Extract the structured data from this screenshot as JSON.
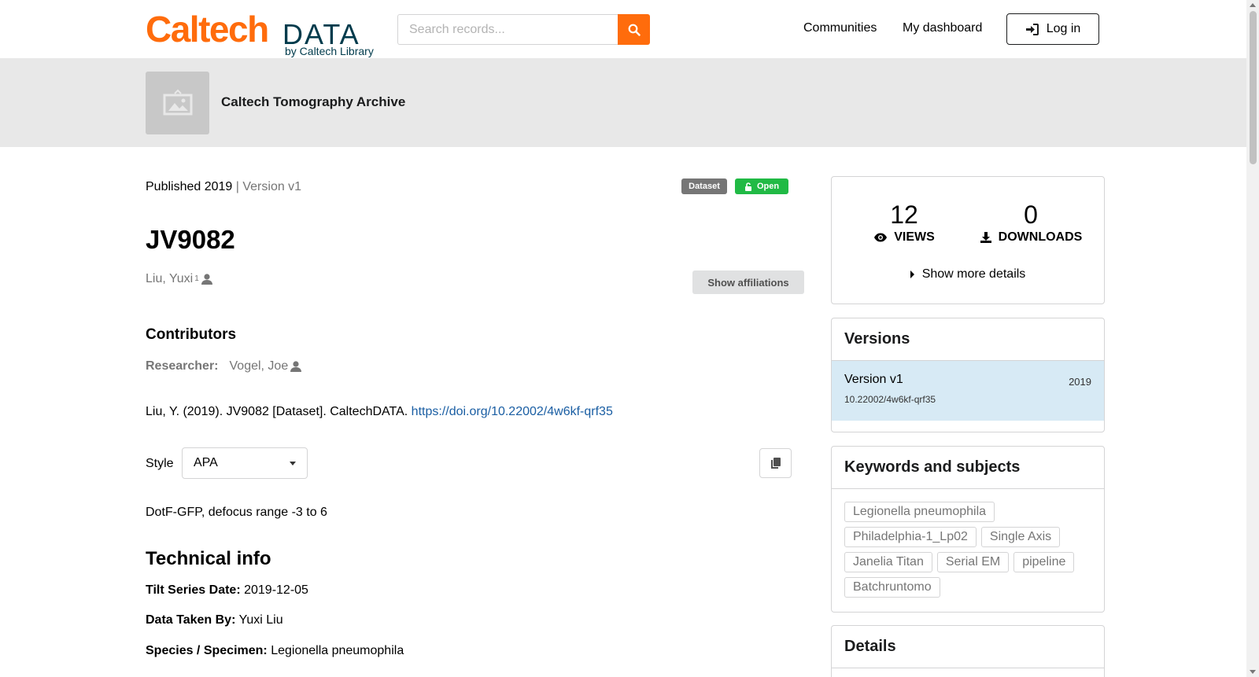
{
  "header": {
    "logo_main": "Caltech",
    "logo_data": "DATA",
    "logo_by": "by Caltech Library",
    "search_placeholder": "Search records...",
    "nav": [
      "Communities",
      "My dashboard"
    ],
    "login_label": "Log in"
  },
  "community": {
    "name": "Caltech Tomography Archive"
  },
  "record": {
    "published": "Published 2019",
    "version": "| Version v1",
    "badge_type": "Dataset",
    "badge_access": "Open",
    "title": "JV9082",
    "creator": "Liu, Yuxi",
    "creator_sup": "1",
    "show_affiliations": "Show affiliations",
    "contributors_heading": "Contributors",
    "researcher_label": "Researcher:",
    "researcher_name": "Vogel, Joe",
    "citation_text": "Liu, Y. (2019). JV9082 [Dataset]. CaltechDATA. ",
    "citation_link": "https://doi.org/10.22002/4w6kf-qrf35",
    "style_label": "Style",
    "style_value": "APA",
    "description": "DotF-GFP, defocus range -3 to 6",
    "technical_heading": "Technical info",
    "technical": [
      {
        "label": "Tilt Series Date:",
        "value": "2019-12-05"
      },
      {
        "label": "Data Taken By:",
        "value": "Yuxi Liu"
      },
      {
        "label": "Species / Specimen:",
        "value": "Legionella pneumophila"
      }
    ]
  },
  "sidebar": {
    "views_count": "12",
    "views_label": "VIEWS",
    "downloads_count": "0",
    "downloads_label": "DOWNLOADS",
    "more_details": "Show more details",
    "versions_heading": "Versions",
    "version_name": "Version v1",
    "version_year": "2019",
    "version_doi": "10.22002/4w6kf-qrf35",
    "keywords_heading": "Keywords and subjects",
    "keywords": [
      "Legionella pneumophila",
      "Philadelphia-1_Lp02",
      "Single Axis",
      "Janelia Titan",
      "Serial EM",
      "pipeline",
      "Batchruntomo"
    ],
    "details_heading": "Details"
  },
  "colors": {
    "brand_orange": "#ff6c0c",
    "brand_navy": "#003b4c",
    "open_green": "#21ba45",
    "link_blue": "#1a5ea3",
    "version_bg": "#d7eaf5"
  }
}
